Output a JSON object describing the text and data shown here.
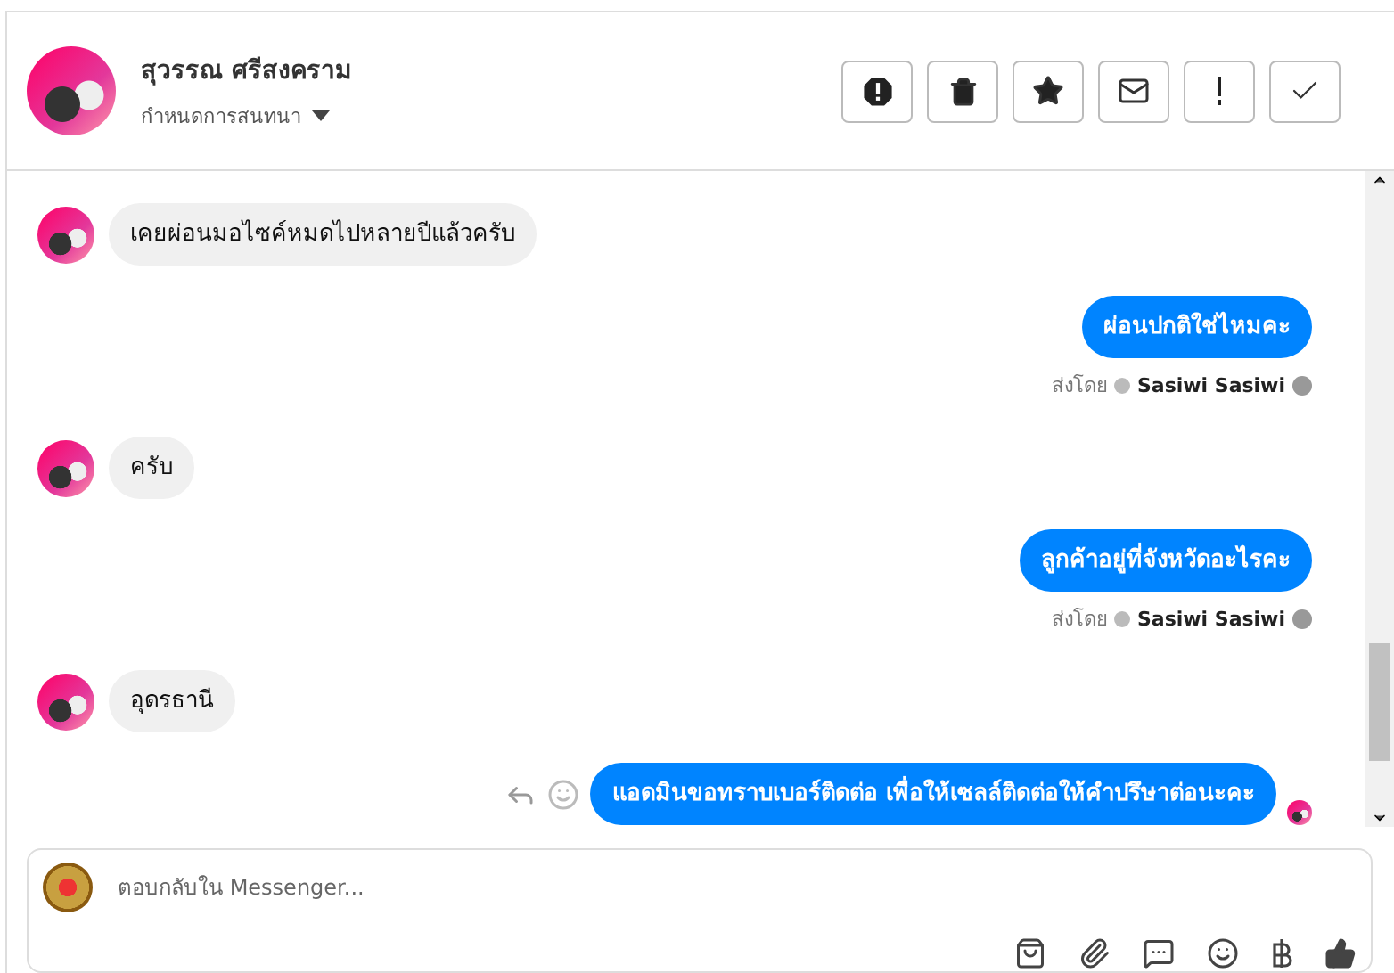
{
  "header": {
    "name": "สุวรรณ ศรีสงคราม",
    "subtitle": "กำหนดการสนทนา"
  },
  "messages": [
    {
      "kind": "incoming",
      "text": "เคยผ่อนมอไซค์หมดไปหลายปีแล้วครับ"
    },
    {
      "kind": "outgoing",
      "text": "ผ่อนปกติใช่ไหมคะ",
      "sent_by_label": "ส่งโดย",
      "sender": "Sasiwi Sasiwi"
    },
    {
      "kind": "incoming",
      "text": "ครับ"
    },
    {
      "kind": "outgoing",
      "text": "ลูกค้าอยู่ที่จังหวัดอะไรคะ",
      "sent_by_label": "ส่งโดย",
      "sender": "Sasiwi Sasiwi"
    },
    {
      "kind": "incoming",
      "text": "อุดรธานี"
    },
    {
      "kind": "outgoing",
      "text": "แอดมินขอทราบเบอร์ติดต่อ เพื่อให้เซลล์ติดต่อให้คำปรึษาต่อนะคะ",
      "seen": true
    }
  ],
  "composer": {
    "placeholder": "ตอบกลับใน Messenger..."
  }
}
